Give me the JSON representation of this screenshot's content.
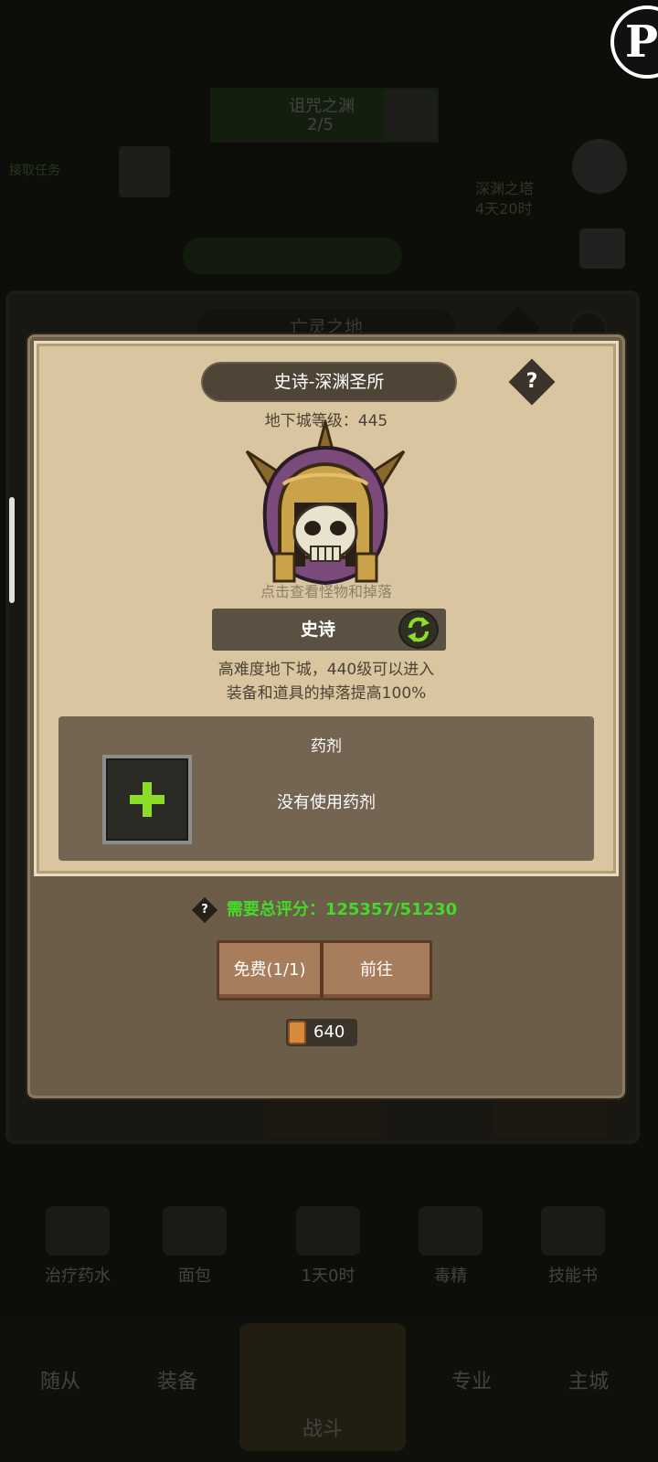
{
  "background": {
    "quest_title": "诅咒之渊",
    "quest_progress": "2/5",
    "task_text": "接取任务",
    "timer_title": "深渊之塔",
    "timer_value": "4天20时",
    "back_panel_title": "亡灵之地",
    "bottom_items": [
      "治疗药水",
      "面包",
      "1天0时",
      "毒精",
      "技能书"
    ],
    "nav": [
      "随从",
      "装备",
      "战斗",
      "专业",
      "主城"
    ]
  },
  "modal": {
    "title": "史诗-深渊圣所",
    "dungeon_level_label": "地下城等级：",
    "dungeon_level_value": "445",
    "hint": "点击查看怪物和掉落",
    "difficulty": "史诗",
    "description_line1": "高难度地下城，440级可以进入",
    "description_line2": "装备和道具的掉落提高100%",
    "potion_title": "药剂",
    "potion_status": "没有使用药剂",
    "score_label": "需要总评分：",
    "score_value": "125357/51230",
    "free_button": "免费(1/1)",
    "go_button": "前往",
    "cost": "640",
    "help_glyph": "?"
  },
  "colors": {
    "parchment": "#d9c6a1",
    "accent_green": "#46d82a",
    "plus_green": "#8cdc2a",
    "button_wood": "#a87d5c"
  },
  "icons": {
    "help": "question-diamond-icon",
    "swap": "swap-arrows-icon",
    "plus": "plus-icon",
    "scroll": "scroll-ticket-icon",
    "boss": "skull-helmet-icon"
  }
}
